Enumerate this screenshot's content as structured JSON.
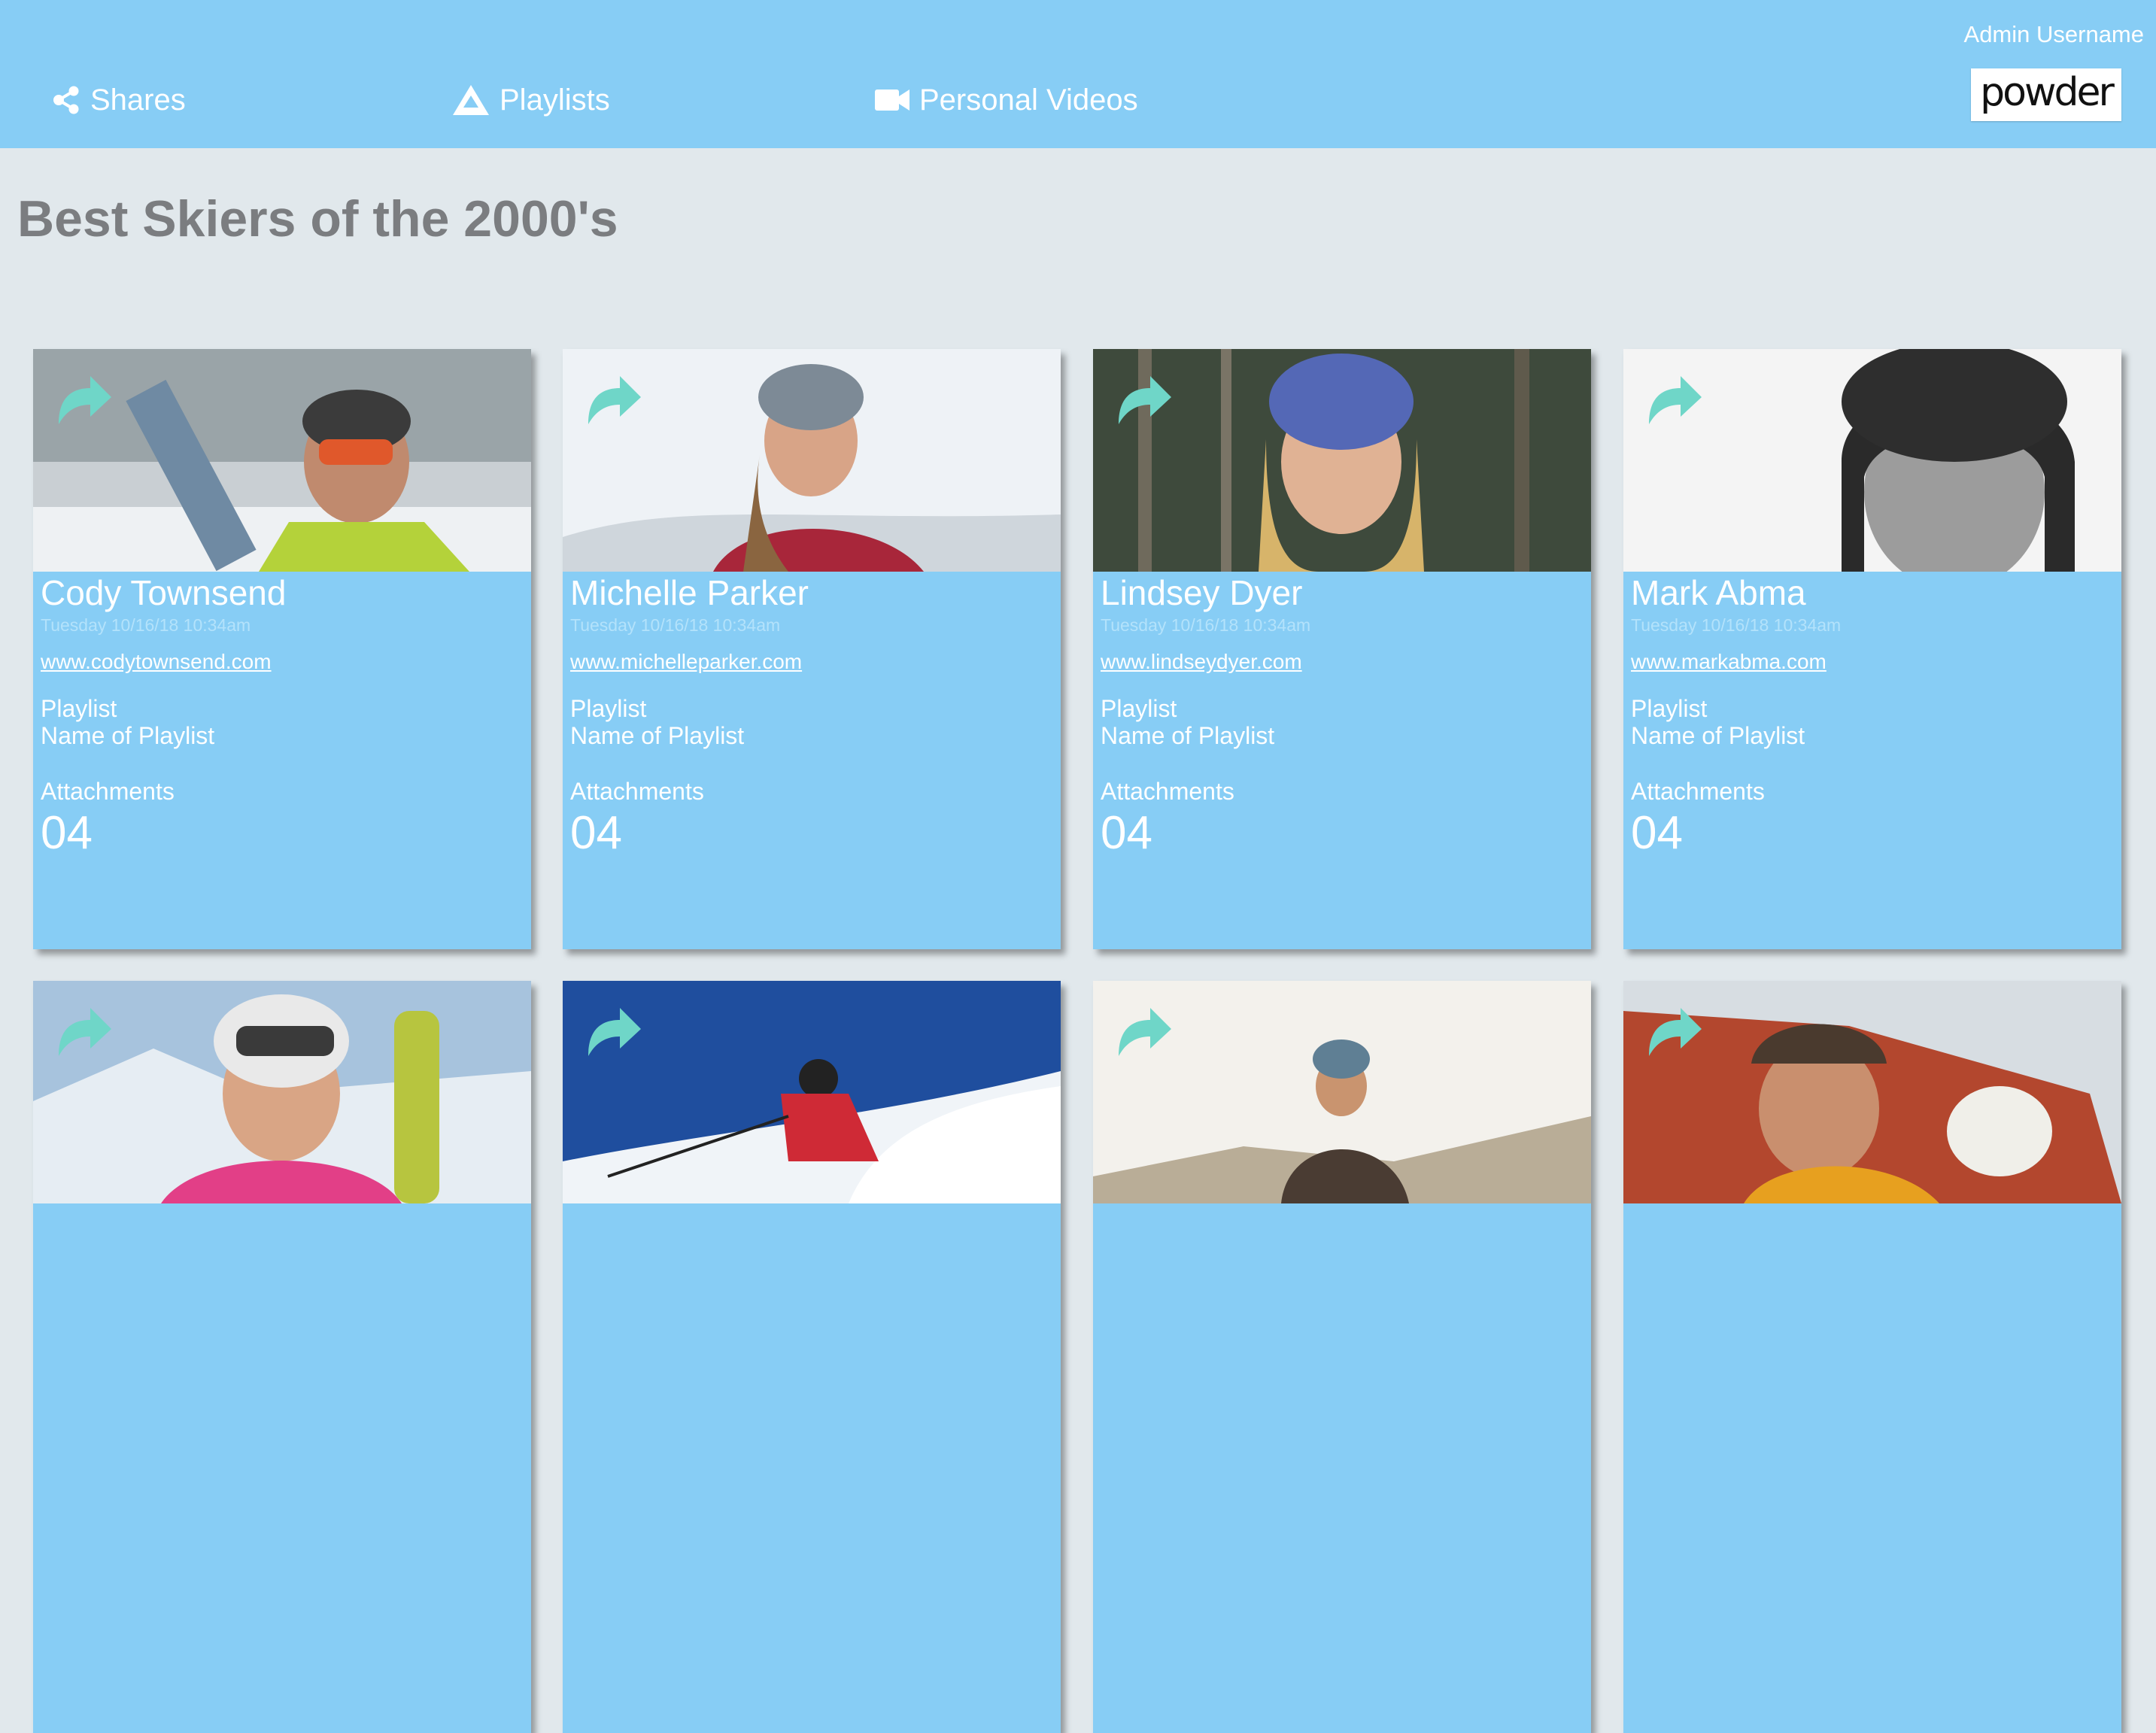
{
  "header": {
    "nav": [
      {
        "label": "Shares",
        "icon": "share-icon"
      },
      {
        "label": "Playlists",
        "icon": "mountain-icon"
      },
      {
        "label": "Personal Videos",
        "icon": "video-camera-icon"
      }
    ],
    "admin_username": "Admin Username",
    "logo_text": "powder"
  },
  "page_title": "Best Skiers of the 2000's",
  "cards": [
    {
      "name": "Cody Townsend",
      "date": "Tuesday 10/16/18 10:34am",
      "website": "www.codytownsend.com",
      "playlist_label": "Playlist",
      "playlist_name": "Name of Playlist",
      "attachments_label": "Attachments",
      "attachments_count": "04"
    },
    {
      "name": "Michelle Parker",
      "date": "Tuesday 10/16/18 10:34am",
      "website": "www.michelleparker.com",
      "playlist_label": "Playlist",
      "playlist_name": "Name of Playlist",
      "attachments_label": "Attachments",
      "attachments_count": "04"
    },
    {
      "name": "Lindsey Dyer",
      "date": "Tuesday 10/16/18 10:34am",
      "website": "www.lindseydyer.com",
      "playlist_label": "Playlist",
      "playlist_name": "Name of Playlist",
      "attachments_label": "Attachments",
      "attachments_count": "04"
    },
    {
      "name": "Mark Abma",
      "date": "Tuesday 10/16/18 10:34am",
      "website": "www.markabma.com",
      "playlist_label": "Playlist",
      "playlist_name": "Name of Playlist",
      "attachments_label": "Attachments",
      "attachments_count": "04"
    },
    {},
    {},
    {},
    {}
  ],
  "colors": {
    "header_bg": "#87cdf5",
    "card_bg": "#87cdf5",
    "page_bg": "#e1e8ec",
    "title_text": "#7b7d80",
    "share_icon": "#6fd6c8"
  }
}
